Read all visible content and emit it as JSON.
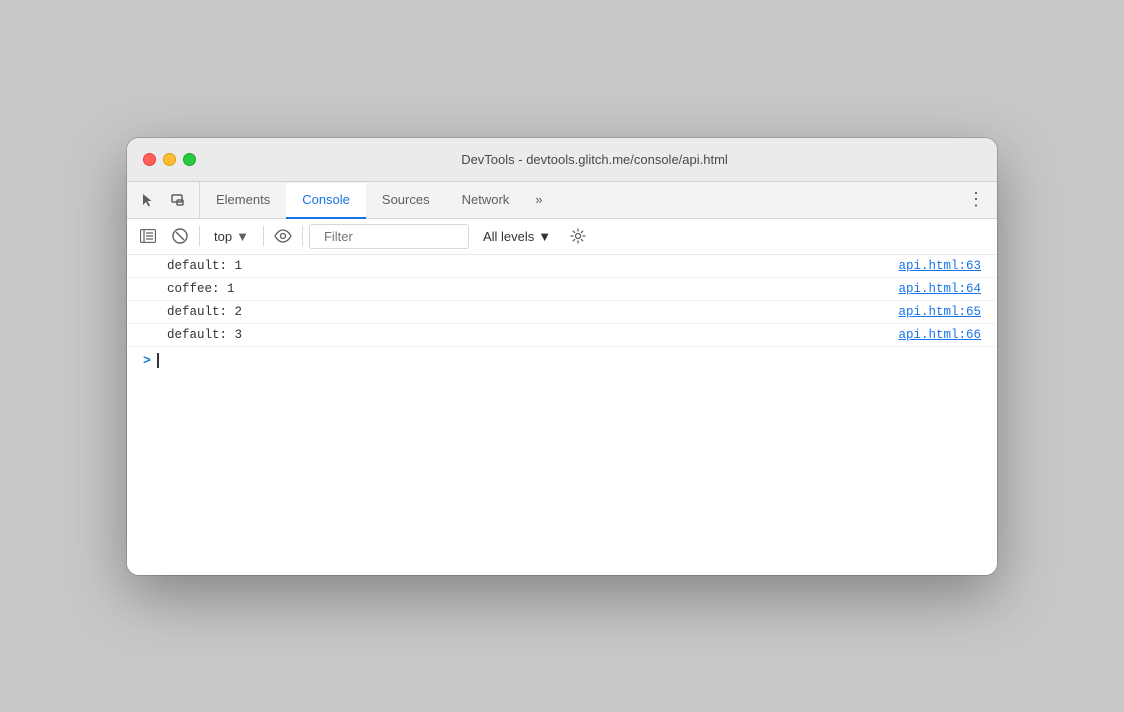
{
  "window": {
    "title": "DevTools - devtools.glitch.me/console/api.html",
    "traffic_lights": {
      "close_label": "close",
      "minimize_label": "minimize",
      "maximize_label": "maximize"
    }
  },
  "tabs": {
    "items": [
      {
        "id": "elements",
        "label": "Elements",
        "active": false
      },
      {
        "id": "console",
        "label": "Console",
        "active": true
      },
      {
        "id": "sources",
        "label": "Sources",
        "active": false
      },
      {
        "id": "network",
        "label": "Network",
        "active": false
      }
    ],
    "more_label": "»",
    "menu_label": "⋮"
  },
  "console_toolbar": {
    "clear_label": "🚫",
    "filter_placeholder": "Filter",
    "context_value": "top",
    "levels_label": "All levels",
    "eye_label": "👁"
  },
  "console_rows": [
    {
      "text": "default: 1",
      "source": "api.html:63"
    },
    {
      "text": "coffee: 1",
      "source": "api.html:64"
    },
    {
      "text": "default: 2",
      "source": "api.html:65"
    },
    {
      "text": "default: 3",
      "source": "api.html:66"
    }
  ],
  "console_input": {
    "prompt": ">"
  }
}
